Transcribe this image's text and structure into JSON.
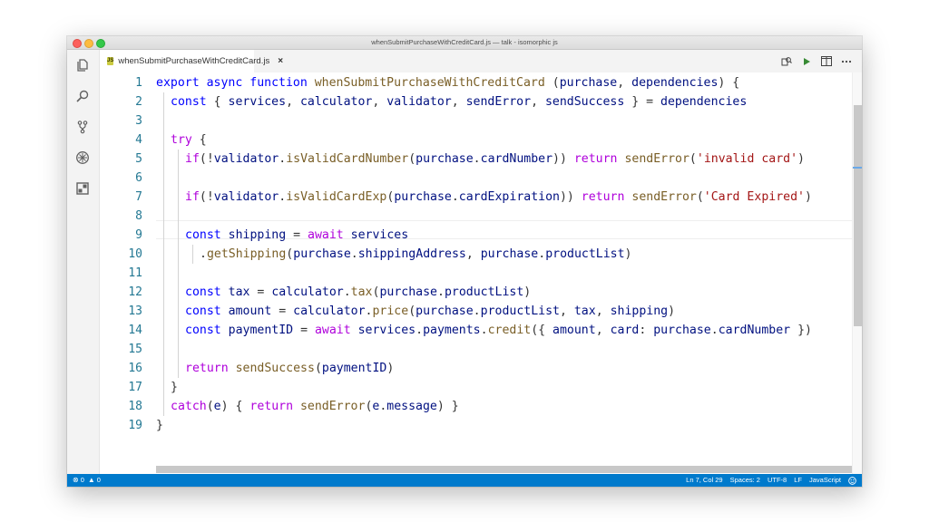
{
  "window": {
    "title": "whenSubmitPurchaseWithCreditCard.js — talk - isomorphic js"
  },
  "activity_bar": {
    "icons": [
      "files-icon",
      "search-icon",
      "source-control-icon",
      "debug-icon",
      "extensions-icon"
    ]
  },
  "tab": {
    "label": "whenSubmitPurchaseWithCreditCard.js",
    "close": "×",
    "icon_label": "JS",
    "icon_color": "#cbcb41"
  },
  "editor_actions": [
    "open-changes-icon",
    "run-icon",
    "split-editor-icon",
    "more-actions-icon"
  ],
  "line_numbers": [
    "1",
    "2",
    "3",
    "4",
    "5",
    "6",
    "7",
    "8",
    "9",
    "10",
    "11",
    "12",
    "13",
    "14",
    "15",
    "16",
    "17",
    "18",
    "19"
  ],
  "code": {
    "l1": [
      {
        "c": "kw",
        "t": "export"
      },
      {
        "c": "plain",
        "t": " "
      },
      {
        "c": "kw",
        "t": "async"
      },
      {
        "c": "plain",
        "t": " "
      },
      {
        "c": "kw",
        "t": "function"
      },
      {
        "c": "plain",
        "t": " "
      },
      {
        "c": "fn",
        "t": "whenSubmitPurchaseWithCreditCard"
      },
      {
        "c": "plain",
        "t": " ("
      },
      {
        "c": "var",
        "t": "purchase"
      },
      {
        "c": "plain",
        "t": ", "
      },
      {
        "c": "var",
        "t": "dependencies"
      },
      {
        "c": "plain",
        "t": ") {"
      }
    ],
    "l2": [
      {
        "c": "kw",
        "t": "const"
      },
      {
        "c": "plain",
        "t": " { "
      },
      {
        "c": "var",
        "t": "services"
      },
      {
        "c": "plain",
        "t": ", "
      },
      {
        "c": "var",
        "t": "calculator"
      },
      {
        "c": "plain",
        "t": ", "
      },
      {
        "c": "var",
        "t": "validator"
      },
      {
        "c": "plain",
        "t": ", "
      },
      {
        "c": "var",
        "t": "sendError"
      },
      {
        "c": "plain",
        "t": ", "
      },
      {
        "c": "var",
        "t": "sendSuccess"
      },
      {
        "c": "plain",
        "t": " } = "
      },
      {
        "c": "var",
        "t": "dependencies"
      }
    ],
    "l3": [],
    "l4": [
      {
        "c": "ctl",
        "t": "try"
      },
      {
        "c": "plain",
        "t": " {"
      }
    ],
    "l5": [
      {
        "c": "ctl",
        "t": "if"
      },
      {
        "c": "plain",
        "t": "(!"
      },
      {
        "c": "var",
        "t": "validator"
      },
      {
        "c": "plain",
        "t": "."
      },
      {
        "c": "fn",
        "t": "isValidCardNumber"
      },
      {
        "c": "plain",
        "t": "("
      },
      {
        "c": "var",
        "t": "purchase"
      },
      {
        "c": "plain",
        "t": "."
      },
      {
        "c": "var",
        "t": "cardNumber"
      },
      {
        "c": "plain",
        "t": ")) "
      },
      {
        "c": "ctl",
        "t": "return"
      },
      {
        "c": "plain",
        "t": " "
      },
      {
        "c": "fn",
        "t": "sendError"
      },
      {
        "c": "plain",
        "t": "("
      },
      {
        "c": "str",
        "t": "'invalid card'"
      },
      {
        "c": "plain",
        "t": ")"
      }
    ],
    "l6": [],
    "l7": [
      {
        "c": "ctl",
        "t": "if"
      },
      {
        "c": "plain",
        "t": "(!"
      },
      {
        "c": "var",
        "t": "validator"
      },
      {
        "c": "plain",
        "t": "."
      },
      {
        "c": "fn",
        "t": "isValidCardExp"
      },
      {
        "c": "plain",
        "t": "("
      },
      {
        "c": "var",
        "t": "purchase"
      },
      {
        "c": "plain",
        "t": "."
      },
      {
        "c": "var",
        "t": "cardExpiration"
      },
      {
        "c": "plain",
        "t": ")) "
      },
      {
        "c": "ctl",
        "t": "return"
      },
      {
        "c": "plain",
        "t": " "
      },
      {
        "c": "fn",
        "t": "sendError"
      },
      {
        "c": "plain",
        "t": "("
      },
      {
        "c": "str",
        "t": "'Card Expired'"
      },
      {
        "c": "plain",
        "t": ")"
      }
    ],
    "l8": [],
    "l9": [
      {
        "c": "kw",
        "t": "const"
      },
      {
        "c": "plain",
        "t": " "
      },
      {
        "c": "var",
        "t": "shipping"
      },
      {
        "c": "plain",
        "t": " = "
      },
      {
        "c": "ctl",
        "t": "await"
      },
      {
        "c": "plain",
        "t": " "
      },
      {
        "c": "var",
        "t": "services"
      }
    ],
    "l10": [
      {
        "c": "plain",
        "t": "."
      },
      {
        "c": "fn",
        "t": "getShipping"
      },
      {
        "c": "plain",
        "t": "("
      },
      {
        "c": "var",
        "t": "purchase"
      },
      {
        "c": "plain",
        "t": "."
      },
      {
        "c": "var",
        "t": "shippingAddress"
      },
      {
        "c": "plain",
        "t": ", "
      },
      {
        "c": "var",
        "t": "purchase"
      },
      {
        "c": "plain",
        "t": "."
      },
      {
        "c": "var",
        "t": "productList"
      },
      {
        "c": "plain",
        "t": ")"
      }
    ],
    "l11": [],
    "l12": [
      {
        "c": "kw",
        "t": "const"
      },
      {
        "c": "plain",
        "t": " "
      },
      {
        "c": "var",
        "t": "tax"
      },
      {
        "c": "plain",
        "t": " = "
      },
      {
        "c": "var",
        "t": "calculator"
      },
      {
        "c": "plain",
        "t": "."
      },
      {
        "c": "fn",
        "t": "tax"
      },
      {
        "c": "plain",
        "t": "("
      },
      {
        "c": "var",
        "t": "purchase"
      },
      {
        "c": "plain",
        "t": "."
      },
      {
        "c": "var",
        "t": "productList"
      },
      {
        "c": "plain",
        "t": ")"
      }
    ],
    "l13": [
      {
        "c": "kw",
        "t": "const"
      },
      {
        "c": "plain",
        "t": " "
      },
      {
        "c": "var",
        "t": "amount"
      },
      {
        "c": "plain",
        "t": " = "
      },
      {
        "c": "var",
        "t": "calculator"
      },
      {
        "c": "plain",
        "t": "."
      },
      {
        "c": "fn",
        "t": "price"
      },
      {
        "c": "plain",
        "t": "("
      },
      {
        "c": "var",
        "t": "purchase"
      },
      {
        "c": "plain",
        "t": "."
      },
      {
        "c": "var",
        "t": "productList"
      },
      {
        "c": "plain",
        "t": ", "
      },
      {
        "c": "var",
        "t": "tax"
      },
      {
        "c": "plain",
        "t": ", "
      },
      {
        "c": "var",
        "t": "shipping"
      },
      {
        "c": "plain",
        "t": ")"
      }
    ],
    "l14": [
      {
        "c": "kw",
        "t": "const"
      },
      {
        "c": "plain",
        "t": " "
      },
      {
        "c": "var",
        "t": "paymentID"
      },
      {
        "c": "plain",
        "t": " = "
      },
      {
        "c": "ctl",
        "t": "await"
      },
      {
        "c": "plain",
        "t": " "
      },
      {
        "c": "var",
        "t": "services"
      },
      {
        "c": "plain",
        "t": "."
      },
      {
        "c": "var",
        "t": "payments"
      },
      {
        "c": "plain",
        "t": "."
      },
      {
        "c": "fn",
        "t": "credit"
      },
      {
        "c": "plain",
        "t": "({ "
      },
      {
        "c": "var",
        "t": "amount"
      },
      {
        "c": "plain",
        "t": ", "
      },
      {
        "c": "var",
        "t": "card"
      },
      {
        "c": "plain",
        "t": ": "
      },
      {
        "c": "var",
        "t": "purchase"
      },
      {
        "c": "plain",
        "t": "."
      },
      {
        "c": "var",
        "t": "cardNumber"
      },
      {
        "c": "plain",
        "t": " })"
      }
    ],
    "l15": [],
    "l16": [
      {
        "c": "ctl",
        "t": "return"
      },
      {
        "c": "plain",
        "t": " "
      },
      {
        "c": "fn",
        "t": "sendSuccess"
      },
      {
        "c": "plain",
        "t": "("
      },
      {
        "c": "var",
        "t": "paymentID"
      },
      {
        "c": "plain",
        "t": ")"
      }
    ],
    "l17": [
      {
        "c": "plain",
        "t": "}"
      }
    ],
    "l18": [
      {
        "c": "ctl",
        "t": "catch"
      },
      {
        "c": "plain",
        "t": "("
      },
      {
        "c": "var",
        "t": "e"
      },
      {
        "c": "plain",
        "t": ") { "
      },
      {
        "c": "ctl",
        "t": "return"
      },
      {
        "c": "plain",
        "t": " "
      },
      {
        "c": "fn",
        "t": "sendError"
      },
      {
        "c": "plain",
        "t": "("
      },
      {
        "c": "var",
        "t": "e"
      },
      {
        "c": "plain",
        "t": "."
      },
      {
        "c": "var",
        "t": "message"
      },
      {
        "c": "plain",
        "t": ") }"
      }
    ],
    "l19": [
      {
        "c": "plain",
        "t": "}"
      }
    ]
  },
  "status_bar": {
    "errors": "0",
    "warnings": "0",
    "cursor": "Ln 7, Col 29",
    "spaces": "Spaces: 2",
    "encoding": "UTF-8",
    "eol": "LF",
    "language": "JavaScript",
    "accent": "#007acc"
  }
}
